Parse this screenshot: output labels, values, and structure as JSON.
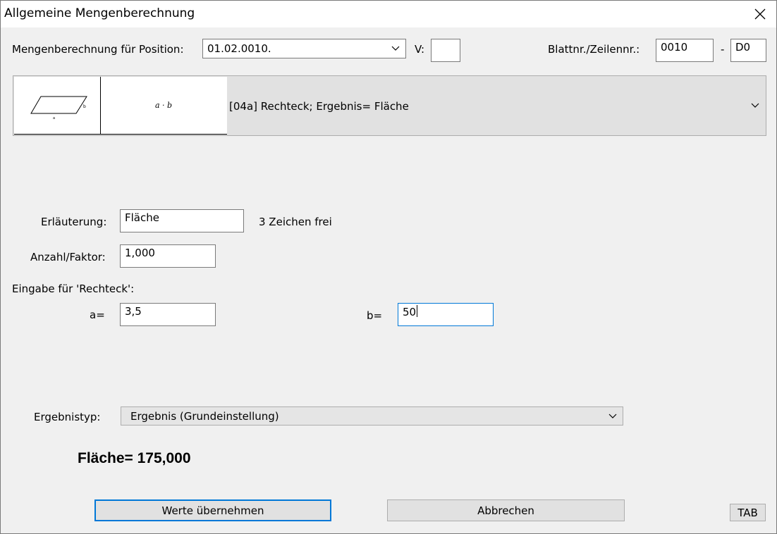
{
  "window": {
    "title": "Allgemeine Mengenberechnung"
  },
  "header": {
    "position_label": "Mengenberechnung für Position:",
    "position_value": "01.02.0010.",
    "v_label": "V:",
    "v_value": "",
    "blatt_label": "Blattnr./Zeilennr.:",
    "blatt_value": "0010",
    "separator": "-",
    "zeile_value": "D0"
  },
  "formula": {
    "selected": "[04a] Rechteck; Ergebnis= Fläche",
    "expression": "a · b",
    "sketch_label_a": "a",
    "sketch_label_b": "b"
  },
  "form": {
    "erlaeuterung_label": "Erläuterung:",
    "erlaeuterung_value": "Fläche",
    "chars_free": "3 Zeichen frei",
    "anzahl_label": "Anzahl/Faktor:",
    "anzahl_value": "1,000",
    "eingabe_label": "Eingabe für 'Rechteck':",
    "a_label": "a=",
    "a_value": "3,5",
    "b_label": "b=",
    "b_value": "50"
  },
  "result": {
    "ergebnistyp_label": "Ergebnistyp:",
    "ergebnistyp_value": "Ergebnis (Grundeinstellung)",
    "result_text": "Fläche= 175,000"
  },
  "buttons": {
    "apply": "Werte übernehmen",
    "cancel": "Abbrechen",
    "tab": "TAB"
  },
  "colors": {
    "focus": "#0078d7",
    "dialog_bg": "#f0f0f0",
    "button_bg": "#e1e1e1"
  },
  "icons": {
    "close": "close-icon",
    "dropdown": "chevron-down-icon"
  }
}
